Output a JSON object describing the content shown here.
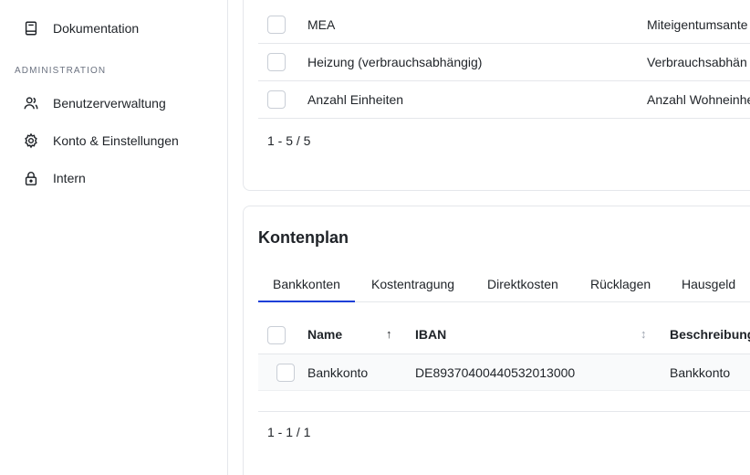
{
  "sidebar": {
    "items_top": [
      {
        "label": "Dokumentation",
        "icon": "book-icon"
      }
    ],
    "section_label": "ADMINISTRATION",
    "items_admin": [
      {
        "label": "Benutzerverwaltung",
        "icon": "users-icon"
      },
      {
        "label": "Konto & Einstellungen",
        "icon": "gear-icon"
      },
      {
        "label": "Intern",
        "icon": "lock-icon"
      }
    ]
  },
  "distribution_table": {
    "rows": [
      {
        "name": "MEA",
        "description": "Miteigentumsante"
      },
      {
        "name": "Heizung (verbrauchsabhängig)",
        "description": "Verbrauchsabhän"
      },
      {
        "name": "Anzahl Einheiten",
        "description": "Anzahl Wohneinhe"
      }
    ],
    "pagination": "1 - 5 / 5"
  },
  "kontenplan": {
    "title": "Kontenplan",
    "tabs": [
      "Bankkonten",
      "Kostentragung",
      "Direktkosten",
      "Rücklagen",
      "Hausgeld"
    ],
    "active_tab": "Bankkonten",
    "columns": {
      "name": "Name",
      "iban": "IBAN",
      "description": "Beschreibung"
    },
    "sort": {
      "name": "↑",
      "iban": "↕"
    },
    "rows": [
      {
        "name": "Bankkonto",
        "iban": "DE89370400440532013000",
        "description": "Bankkonto"
      }
    ],
    "pagination": "1 - 1 / 1"
  },
  "colors": {
    "accent": "#1d3fd8",
    "border": "#e5e7eb"
  }
}
